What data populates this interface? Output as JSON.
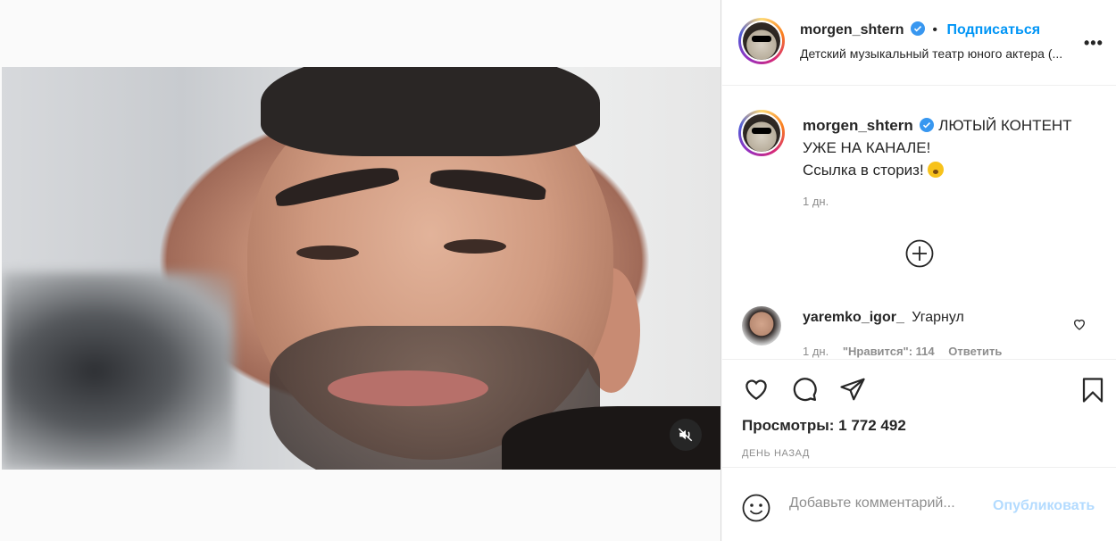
{
  "post": {
    "username": "morgen_shtern",
    "follow_label": "Подписаться",
    "location": "Детский музыкальный театр юного актера (...",
    "more_label": "•••",
    "caption_line1": "ЛЮТЫЙ КОНТЕНТ",
    "caption_line2": "УЖЕ НА КАНАЛЕ!",
    "caption_line3": "Ссылка в сториз!",
    "caption_time": "1 дн.",
    "views_label": "Просмотры: 1 772 492",
    "posted_ago": "день назад"
  },
  "comment": {
    "username": "yaremko_igor_",
    "text": "Угарнул",
    "time": "1 дн.",
    "likes": "\"Нравится\": 114",
    "reply": "Ответить"
  },
  "add_comment": {
    "placeholder": "Добавьте комментарий...",
    "publish_label": "Опубликовать"
  },
  "colors": {
    "accent": "#0095f6",
    "verified": "#3897f0",
    "muted_text": "#8e8e8e",
    "publish_disabled": "#b3dbff"
  },
  "icons": {
    "mute": "speaker-muted-icon",
    "like": "heart-icon",
    "comment": "comment-bubble-icon",
    "share": "paper-plane-icon",
    "save": "bookmark-icon",
    "emoji": "smiley-icon",
    "load_more": "plus-circle-icon",
    "verified": "verified-badge-icon"
  }
}
